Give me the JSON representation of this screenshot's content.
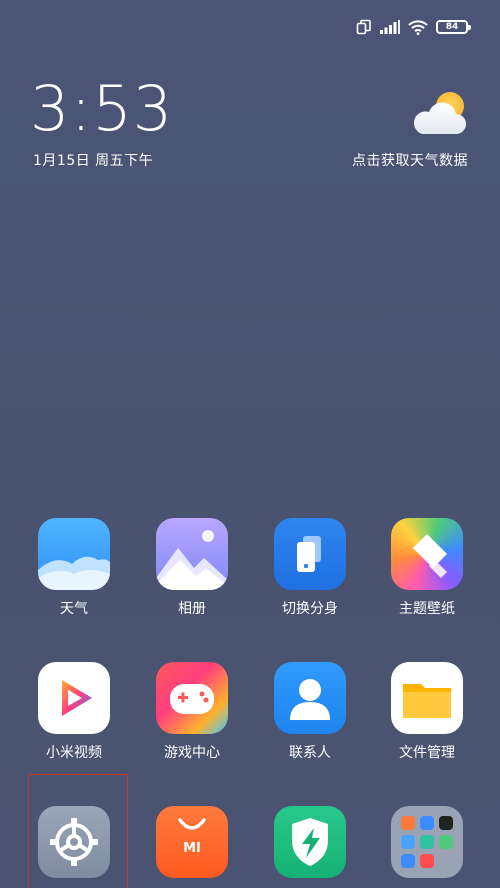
{
  "status_bar": {
    "battery_level": "84",
    "icons": [
      "dual-screen-icon",
      "signal-icon",
      "wifi-icon",
      "battery-icon"
    ]
  },
  "clock": {
    "time": "3:53",
    "date": "1月15日 周五下午"
  },
  "weather": {
    "prompt": "点击获取天气数据",
    "icon": "partly-cloudy-icon"
  },
  "apps": [
    {
      "id": "weather",
      "label": "天气"
    },
    {
      "id": "gallery",
      "label": "相册"
    },
    {
      "id": "dual-space",
      "label": "切换分身"
    },
    {
      "id": "themes",
      "label": "主题壁纸"
    },
    {
      "id": "mi-video",
      "label": "小米视频"
    },
    {
      "id": "game-center",
      "label": "游戏中心"
    },
    {
      "id": "contacts",
      "label": "联系人"
    },
    {
      "id": "file-manager",
      "label": "文件管理"
    },
    {
      "id": "settings",
      "label": ""
    },
    {
      "id": "mi-store",
      "label": ""
    },
    {
      "id": "security",
      "label": ""
    },
    {
      "id": "folder",
      "label": ""
    }
  ],
  "colors": {
    "background": "#4a5474",
    "highlight_box": "#c0392b"
  }
}
